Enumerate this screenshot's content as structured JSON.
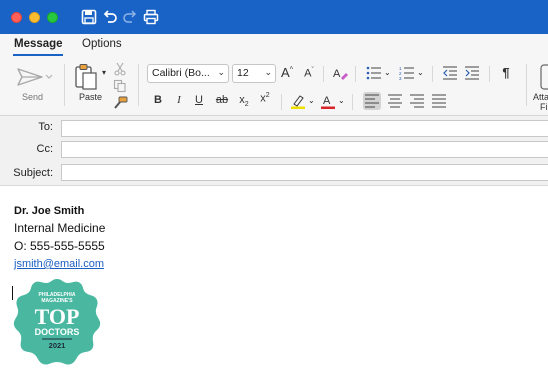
{
  "tabs": {
    "message": "Message",
    "options": "Options"
  },
  "ribbon": {
    "send_label": "Send",
    "paste_label": "Paste",
    "font_name": "Calibri (Bo...",
    "font_size": "12",
    "grow_font": "A",
    "shrink_font": "A",
    "bold": "B",
    "italic": "I",
    "underline": "U",
    "strike": "ab",
    "subscript": "x",
    "superscript": "x",
    "pilcrow": "¶",
    "attach_partial": "Atta",
    "attach_partial2": "Fi",
    "highlight_color": "#f0e000",
    "font_color": "#d9242b"
  },
  "fields": {
    "to_label": "To:",
    "cc_label": "Cc:",
    "subject_label": "Subject:"
  },
  "signature": {
    "name": "Dr. Joe Smith",
    "department": "Internal Medicine",
    "phone": "O: 555-555-5555",
    "email": "jsmith@email.com"
  },
  "badge": {
    "line1": "PHILADELPHIA",
    "line2": "MAGAZINE'S",
    "top": "TOP",
    "doctors": "DOCTORS",
    "year": "2021",
    "color": "#4ab8a1"
  },
  "colors": {
    "titlebar": "#1a63c6",
    "link": "#1c5fc2"
  }
}
